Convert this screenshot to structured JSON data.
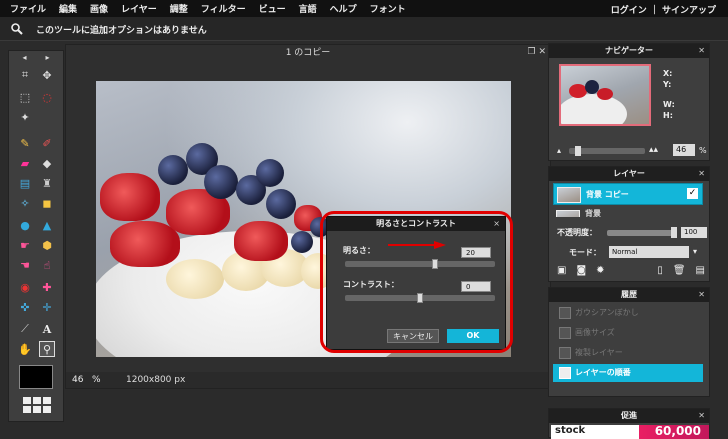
{
  "menubar": {
    "items": [
      "ファイル",
      "編集",
      "画像",
      "レイヤー",
      "調整",
      "フィルター",
      "ビュー",
      "言語",
      "ヘルプ",
      "フォント"
    ],
    "right": "ログイン ｜ サインアップ"
  },
  "optionbar": {
    "message": "このツールに追加オプションはありません"
  },
  "document": {
    "title": "1 のコピー",
    "zoom": "46",
    "zoom_unit": "%",
    "dimensions": "1200x800 px"
  },
  "dialog": {
    "title": "明るさとコントラスト",
    "brightness_label": "明るさ：",
    "brightness_value": "20",
    "brightness_fraction": 0.6,
    "contrast_label": "コントラスト：",
    "contrast_value": "0",
    "contrast_fraction": 0.5,
    "cancel": "キャンセル",
    "ok": "OK",
    "close": "×"
  },
  "navigator": {
    "title": "ナビゲーター",
    "x_label": "X:",
    "y_label": "Y:",
    "w_label": "W:",
    "h_label": "H:",
    "zoom": "46",
    "zoom_unit": "%"
  },
  "layers": {
    "title": "レイヤー",
    "items": [
      {
        "name": "背景 コピー",
        "visible": true
      },
      {
        "name": "背景",
        "visible": true
      }
    ],
    "opacity_label": "不透明度：",
    "opacity_value": "100",
    "mode_label": "モード：",
    "mode_value": "Normal"
  },
  "history": {
    "title": "履歴",
    "items": [
      "ガウシアンぼかし",
      "画像サイズ",
      "複製レイヤー",
      "レイヤーの順番"
    ]
  },
  "promo": {
    "title": "促進",
    "brand": "stock",
    "number": "60,000"
  },
  "colors": {
    "accent": "#13b6d9",
    "highlight": "#e00000"
  }
}
